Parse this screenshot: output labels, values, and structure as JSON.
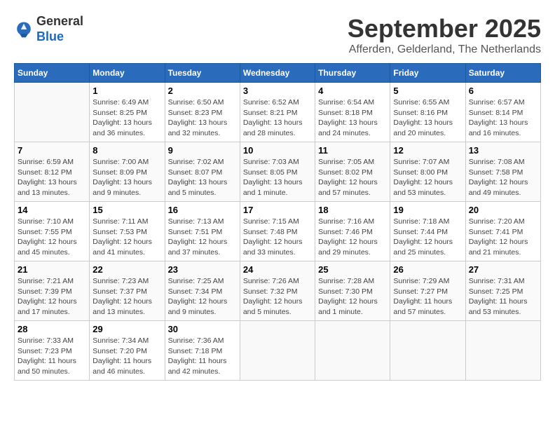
{
  "header": {
    "logo_line1": "General",
    "logo_line2": "Blue",
    "month_title": "September 2025",
    "location": "Afferden, Gelderland, The Netherlands"
  },
  "columns": [
    "Sunday",
    "Monday",
    "Tuesday",
    "Wednesday",
    "Thursday",
    "Friday",
    "Saturday"
  ],
  "weeks": [
    [
      {
        "day": "",
        "content": ""
      },
      {
        "day": "1",
        "content": "Sunrise: 6:49 AM\nSunset: 8:25 PM\nDaylight: 13 hours\nand 36 minutes."
      },
      {
        "day": "2",
        "content": "Sunrise: 6:50 AM\nSunset: 8:23 PM\nDaylight: 13 hours\nand 32 minutes."
      },
      {
        "day": "3",
        "content": "Sunrise: 6:52 AM\nSunset: 8:21 PM\nDaylight: 13 hours\nand 28 minutes."
      },
      {
        "day": "4",
        "content": "Sunrise: 6:54 AM\nSunset: 8:18 PM\nDaylight: 13 hours\nand 24 minutes."
      },
      {
        "day": "5",
        "content": "Sunrise: 6:55 AM\nSunset: 8:16 PM\nDaylight: 13 hours\nand 20 minutes."
      },
      {
        "day": "6",
        "content": "Sunrise: 6:57 AM\nSunset: 8:14 PM\nDaylight: 13 hours\nand 16 minutes."
      }
    ],
    [
      {
        "day": "7",
        "content": "Sunrise: 6:59 AM\nSunset: 8:12 PM\nDaylight: 13 hours\nand 13 minutes."
      },
      {
        "day": "8",
        "content": "Sunrise: 7:00 AM\nSunset: 8:09 PM\nDaylight: 13 hours\nand 9 minutes."
      },
      {
        "day": "9",
        "content": "Sunrise: 7:02 AM\nSunset: 8:07 PM\nDaylight: 13 hours\nand 5 minutes."
      },
      {
        "day": "10",
        "content": "Sunrise: 7:03 AM\nSunset: 8:05 PM\nDaylight: 13 hours\nand 1 minute."
      },
      {
        "day": "11",
        "content": "Sunrise: 7:05 AM\nSunset: 8:02 PM\nDaylight: 12 hours\nand 57 minutes."
      },
      {
        "day": "12",
        "content": "Sunrise: 7:07 AM\nSunset: 8:00 PM\nDaylight: 12 hours\nand 53 minutes."
      },
      {
        "day": "13",
        "content": "Sunrise: 7:08 AM\nSunset: 7:58 PM\nDaylight: 12 hours\nand 49 minutes."
      }
    ],
    [
      {
        "day": "14",
        "content": "Sunrise: 7:10 AM\nSunset: 7:55 PM\nDaylight: 12 hours\nand 45 minutes."
      },
      {
        "day": "15",
        "content": "Sunrise: 7:11 AM\nSunset: 7:53 PM\nDaylight: 12 hours\nand 41 minutes."
      },
      {
        "day": "16",
        "content": "Sunrise: 7:13 AM\nSunset: 7:51 PM\nDaylight: 12 hours\nand 37 minutes."
      },
      {
        "day": "17",
        "content": "Sunrise: 7:15 AM\nSunset: 7:48 PM\nDaylight: 12 hours\nand 33 minutes."
      },
      {
        "day": "18",
        "content": "Sunrise: 7:16 AM\nSunset: 7:46 PM\nDaylight: 12 hours\nand 29 minutes."
      },
      {
        "day": "19",
        "content": "Sunrise: 7:18 AM\nSunset: 7:44 PM\nDaylight: 12 hours\nand 25 minutes."
      },
      {
        "day": "20",
        "content": "Sunrise: 7:20 AM\nSunset: 7:41 PM\nDaylight: 12 hours\nand 21 minutes."
      }
    ],
    [
      {
        "day": "21",
        "content": "Sunrise: 7:21 AM\nSunset: 7:39 PM\nDaylight: 12 hours\nand 17 minutes."
      },
      {
        "day": "22",
        "content": "Sunrise: 7:23 AM\nSunset: 7:37 PM\nDaylight: 12 hours\nand 13 minutes."
      },
      {
        "day": "23",
        "content": "Sunrise: 7:25 AM\nSunset: 7:34 PM\nDaylight: 12 hours\nand 9 minutes."
      },
      {
        "day": "24",
        "content": "Sunrise: 7:26 AM\nSunset: 7:32 PM\nDaylight: 12 hours\nand 5 minutes."
      },
      {
        "day": "25",
        "content": "Sunrise: 7:28 AM\nSunset: 7:30 PM\nDaylight: 12 hours\nand 1 minute."
      },
      {
        "day": "26",
        "content": "Sunrise: 7:29 AM\nSunset: 7:27 PM\nDaylight: 11 hours\nand 57 minutes."
      },
      {
        "day": "27",
        "content": "Sunrise: 7:31 AM\nSunset: 7:25 PM\nDaylight: 11 hours\nand 53 minutes."
      }
    ],
    [
      {
        "day": "28",
        "content": "Sunrise: 7:33 AM\nSunset: 7:23 PM\nDaylight: 11 hours\nand 50 minutes."
      },
      {
        "day": "29",
        "content": "Sunrise: 7:34 AM\nSunset: 7:20 PM\nDaylight: 11 hours\nand 46 minutes."
      },
      {
        "day": "30",
        "content": "Sunrise: 7:36 AM\nSunset: 7:18 PM\nDaylight: 11 hours\nand 42 minutes."
      },
      {
        "day": "",
        "content": ""
      },
      {
        "day": "",
        "content": ""
      },
      {
        "day": "",
        "content": ""
      },
      {
        "day": "",
        "content": ""
      }
    ]
  ]
}
